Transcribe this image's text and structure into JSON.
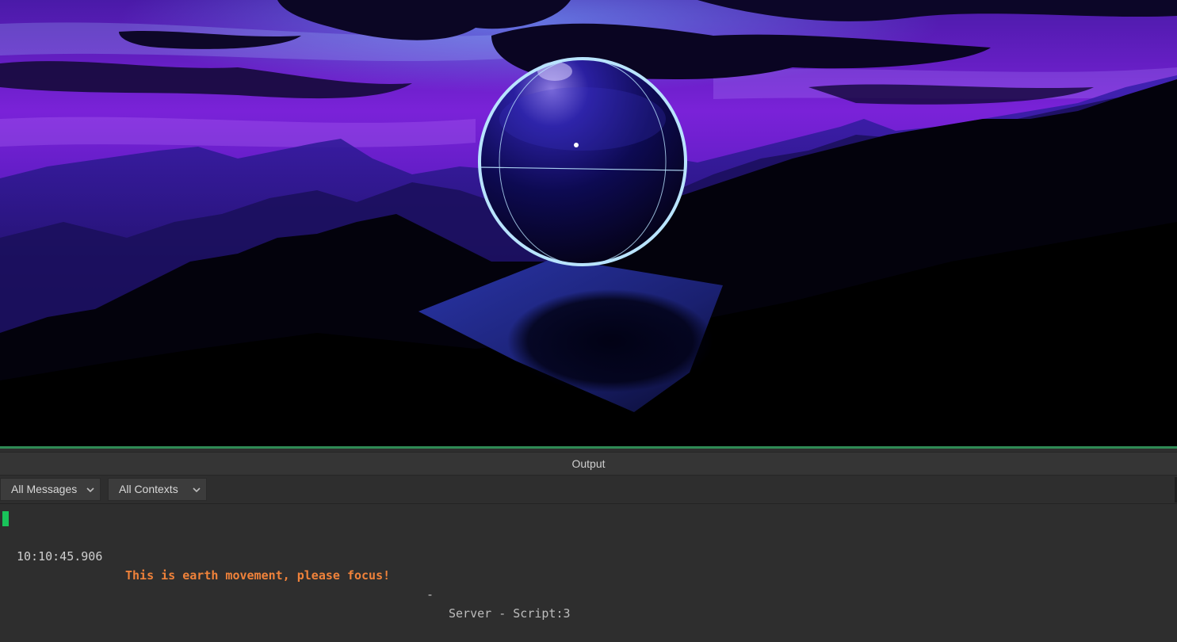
{
  "viewport": {
    "scene": "3d-viewport",
    "sky_colors": [
      "#1a0a4a",
      "#5a18c8",
      "#9b2ee8",
      "#3a1390"
    ],
    "selection_color": "#b9e4ff"
  },
  "output_panel": {
    "title": "Output",
    "filters": {
      "messages": "All Messages",
      "contexts": "All Contexts"
    },
    "log": [
      {
        "time": "10:10:45.906",
        "message": "This is earth movement, please focus!",
        "separator": "-",
        "source": "Server - Script:3",
        "message_color": "#f0823a",
        "marker_color": "#19c35a"
      }
    ]
  }
}
